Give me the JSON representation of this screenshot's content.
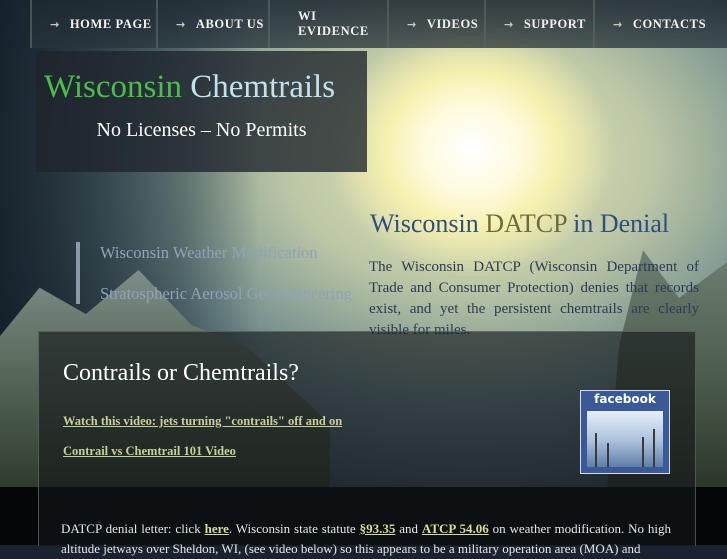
{
  "nav": {
    "items": [
      {
        "label": "HOME PAGE",
        "arrow": "→"
      },
      {
        "label": "ABOUT US",
        "arrow": "→"
      },
      {
        "label": "WI EVIDENCE",
        "arrow": ""
      },
      {
        "label": "VIDEOS",
        "arrow": "→"
      },
      {
        "label": "SUPPORT",
        "arrow": "→"
      },
      {
        "label": "CONTACTS",
        "arrow": "→"
      }
    ]
  },
  "header": {
    "title_part1": "Wisconsin",
    "title_part2": "Chemtrails",
    "tagline": "No Licenses – No Permits"
  },
  "side_links": [
    "Wisconsin Weather Modification",
    "Stratospheric Aerosol Geoengineering"
  ],
  "datcp": {
    "title_a": "Wisconsin",
    "title_b": "DATCP",
    "title_c": "in Denial",
    "body": "The Wisconsin DATCP (Wisconsin Department of Trade and Consumer Protection) denies that records exist, and yet the persistent chemtrails are clearly visible for miles."
  },
  "panel": {
    "title": "Contrails or Chemtrails?",
    "link1": "Watch this video: jets turning \"contrails\" off and on",
    "link2": "Contrail vs Chemtrail 101 Video",
    "facebook_label": "facebook",
    "text_before": "DATCP denial letter: click ",
    "link_here": "here",
    "text_mid": ". Wisconsin state statute ",
    "link_statute": "§93.35",
    "text_and": " and ",
    "link_atcp": "ATCP 54.06",
    "text_after": " on weather modification. No high altitude jetways over Sheldon, WI, (see video below) so this appears to be a military operation area (MOA) and"
  },
  "colors": {
    "title_green": "#4cbc4c",
    "title_light_blue": "#bfe3ee",
    "facebook_blue": "#3b5998",
    "link_olive": "#c8cf9a"
  }
}
